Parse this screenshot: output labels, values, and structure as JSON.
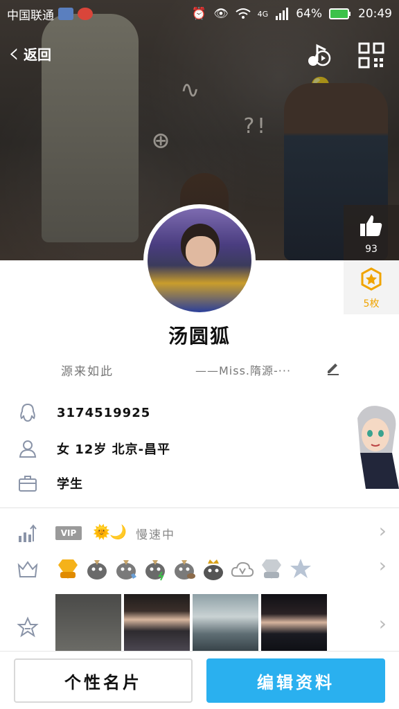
{
  "status_bar": {
    "carrier": "中国联通",
    "network": "4G",
    "battery": "64%",
    "time": "20:49"
  },
  "nav": {
    "back_label": "返回"
  },
  "like_panel": {
    "like_count": "93",
    "badge_count": "5枚"
  },
  "profile": {
    "nickname": "汤圆狐",
    "signature_left": "源来如此",
    "signature_right": "——Miss.隋源-···",
    "qq_number": "3174519925",
    "details": "女  12岁  北京-昌平",
    "occupation": "学生"
  },
  "vip": {
    "badge": "VIP",
    "status": "慢速中"
  },
  "buttons": {
    "card": "个性名片",
    "edit": "编辑资料"
  },
  "colors": {
    "accent": "#2ab0ef",
    "like_badge": "#f0a400"
  }
}
